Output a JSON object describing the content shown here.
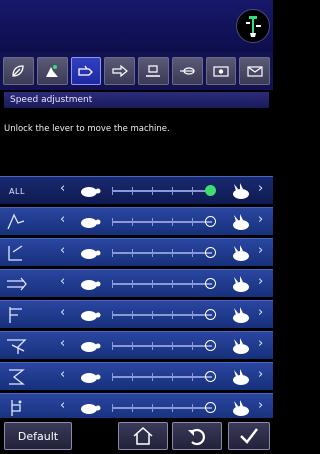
{
  "header": {
    "machine_icon": "sewing-machine-icon"
  },
  "tabs": [
    {
      "icon": "leaf-icon",
      "active": false
    },
    {
      "icon": "presser-foot-icon",
      "active": false
    },
    {
      "icon": "speed-foot-icon",
      "active": true
    },
    {
      "icon": "arrow-right-icon",
      "active": false
    },
    {
      "icon": "stitch-icon",
      "active": false
    },
    {
      "icon": "thread-icon",
      "active": false
    },
    {
      "icon": "card-icon",
      "active": false
    },
    {
      "icon": "mail-icon",
      "active": false
    }
  ],
  "section": {
    "title": "Speed adjustment"
  },
  "message": "Unlock the lever to move the machine.",
  "rows": [
    {
      "label": "ALL",
      "icon": "all-label",
      "level": 1.0,
      "highlight": true
    },
    {
      "label": "",
      "icon": "stitch-mode-1-icon",
      "level": 1.0,
      "highlight": false
    },
    {
      "label": "",
      "icon": "stitch-mode-2-icon",
      "level": 1.0,
      "highlight": false
    },
    {
      "label": "",
      "icon": "stitch-mode-3-icon",
      "level": 1.0,
      "highlight": false
    },
    {
      "label": "",
      "icon": "stitch-mode-4-icon",
      "level": 1.0,
      "highlight": false
    },
    {
      "label": "",
      "icon": "stitch-mode-5-icon",
      "level": 1.0,
      "highlight": false
    },
    {
      "label": "",
      "icon": "stitch-mode-6-icon",
      "level": 1.0,
      "highlight": false
    },
    {
      "label": "",
      "icon": "stitch-mode-7-icon",
      "level": 1.0,
      "highlight": false
    }
  ],
  "footer": {
    "default_label": "Default"
  },
  "colors": {
    "accent": "#3fdc70",
    "panel": "#1e3a8e",
    "topbar": "#14145e"
  }
}
